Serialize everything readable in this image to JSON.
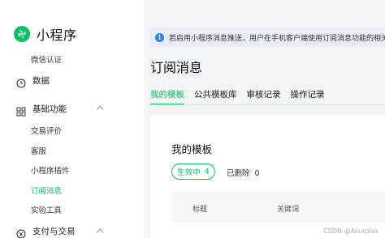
{
  "brand": {
    "title": "小程序",
    "logo_icon": "mini-program-logo-icon",
    "accent": "#07c160"
  },
  "sidebar": {
    "items": [
      {
        "kind": "sub",
        "label": "微信认证"
      },
      {
        "kind": "group",
        "label": "数据",
        "icon": "clock-icon"
      },
      {
        "kind": "group",
        "label": "基础功能",
        "icon": "grid-icon",
        "expanded": true
      },
      {
        "kind": "sub",
        "label": "交易评价"
      },
      {
        "kind": "sub",
        "label": "客服"
      },
      {
        "kind": "sub",
        "label": "小程序插件"
      },
      {
        "kind": "sub",
        "label": "订阅消息",
        "active": true
      },
      {
        "kind": "sub",
        "label": "实验工具"
      },
      {
        "kind": "group",
        "label": "支付与交易",
        "icon": "wallet-icon",
        "expanded": true
      }
    ]
  },
  "notice": {
    "icon": "info-icon",
    "text": "若启用小程序消息推送，用户在手机客户端使用订阅消息功能的相关"
  },
  "page": {
    "title": "订阅消息"
  },
  "tabs": [
    {
      "label": "我的模板",
      "active": true
    },
    {
      "label": "公共模板库"
    },
    {
      "label": "审核记录"
    },
    {
      "label": "操作记录"
    }
  ],
  "card": {
    "title": "我的模板",
    "active_filter": {
      "label": "生效中",
      "count": "4"
    },
    "deleted_filter": {
      "label": "已删除",
      "count": "0"
    },
    "table": {
      "headers": [
        "标题",
        "关键词"
      ]
    }
  },
  "watermark": "CSDN @Asurplus"
}
